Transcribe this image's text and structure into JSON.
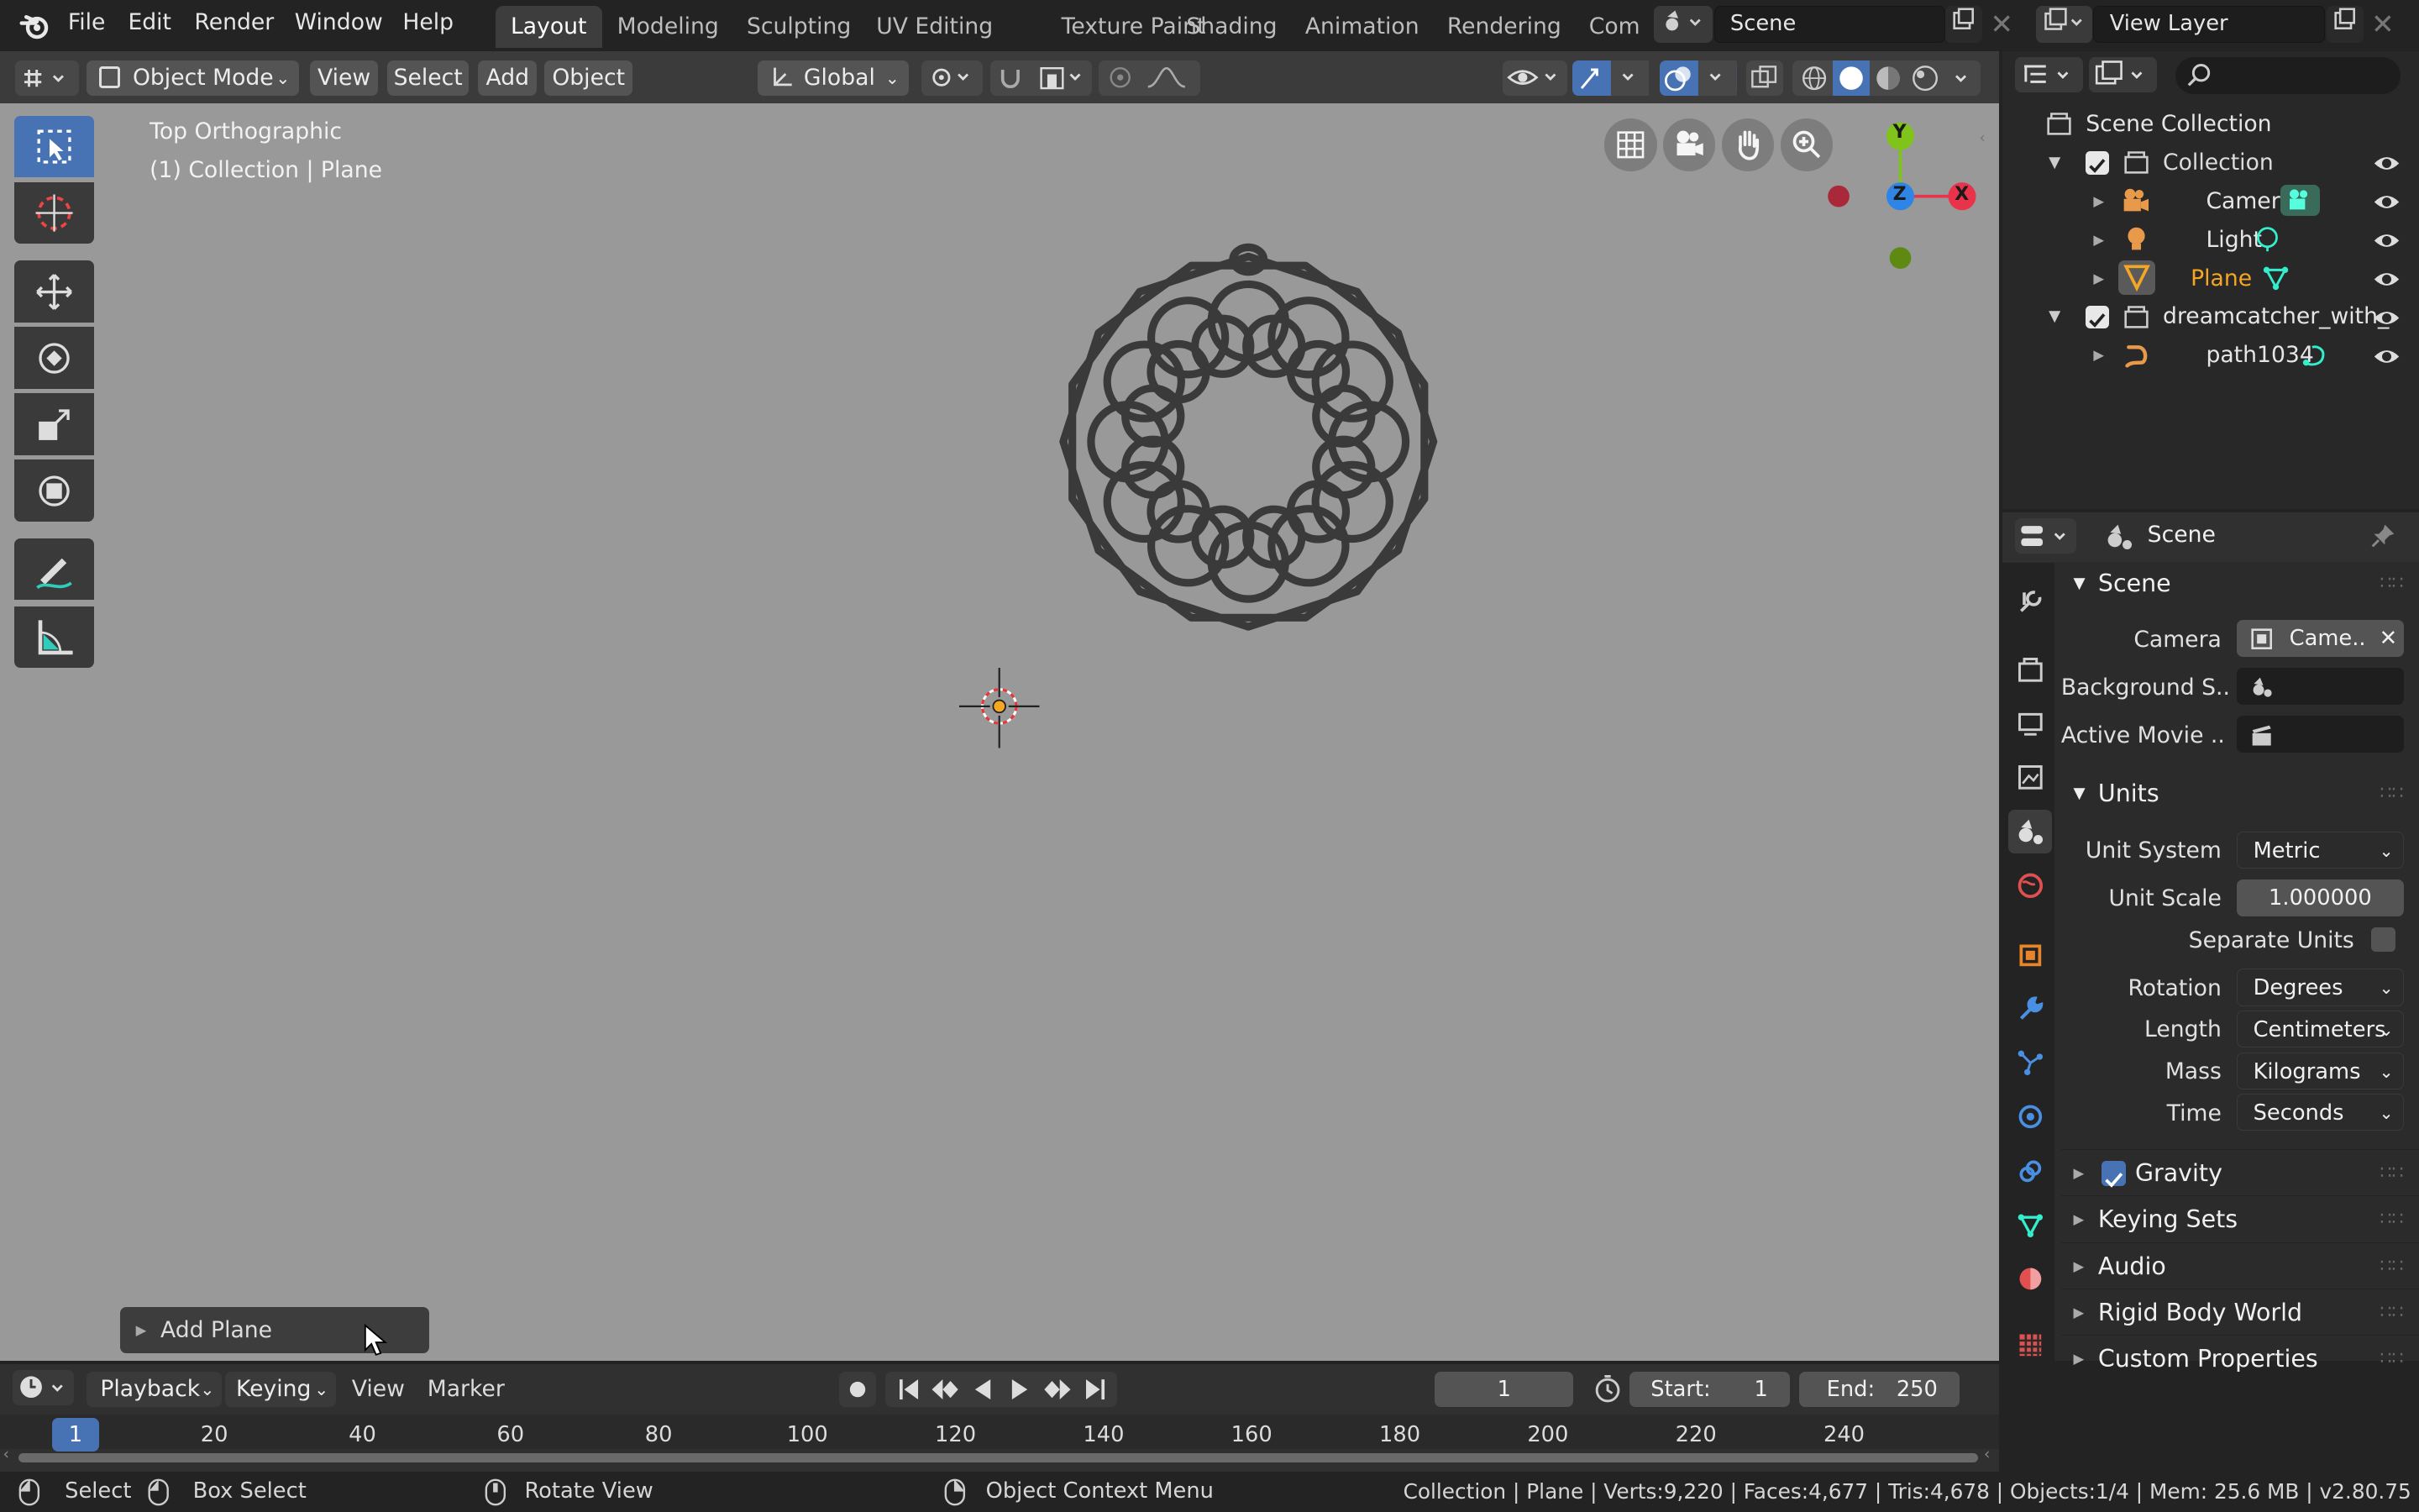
{
  "menus": [
    "File",
    "Edit",
    "Render",
    "Window",
    "Help"
  ],
  "workspaces": [
    "Layout",
    "Modeling",
    "Sculpting",
    "UV Editing",
    "Texture Paint",
    "Shading",
    "Animation",
    "Rendering",
    "Com"
  ],
  "scene_field": "Scene",
  "view_layer_field": "View Layer",
  "viewport_header": {
    "mode": "Object Mode",
    "view": "View",
    "select": "Select",
    "add": "Add",
    "object": "Object",
    "orientation": "Global"
  },
  "viewport": {
    "view_name": "Top Orthographic",
    "collection_info": "(1) Collection | Plane",
    "gizmo": {
      "y": "Y",
      "z": "Z",
      "x": "X"
    }
  },
  "operator_panel": "Add Plane",
  "outliner": {
    "scene_collection": "Scene Collection",
    "items": [
      {
        "label": "Collection",
        "type": "collection"
      },
      {
        "label": "Camera",
        "type": "camera"
      },
      {
        "label": "Light",
        "type": "light"
      },
      {
        "label": "Plane",
        "type": "mesh"
      },
      {
        "label": "dreamcatcher_with_",
        "type": "collection"
      },
      {
        "label": "path1034",
        "type": "curve"
      }
    ]
  },
  "properties": {
    "header": "Scene",
    "scene_section": "Scene",
    "camera_label": "Camera",
    "camera_value": "Came..",
    "background_label": "Background S..",
    "movie_label": "Active Movie ..",
    "units_section": "Units",
    "unit_system_label": "Unit System",
    "unit_system_value": "Metric",
    "unit_scale_label": "Unit Scale",
    "unit_scale_value": "1.000000",
    "separate_units_label": "Separate Units",
    "rotation_label": "Rotation",
    "rotation_value": "Degrees",
    "length_label": "Length",
    "length_value": "Centimeters",
    "mass_label": "Mass",
    "mass_value": "Kilograms",
    "time_label": "Time",
    "time_value": "Seconds",
    "collapsed_sections": [
      "Gravity",
      "Keying Sets",
      "Audio",
      "Rigid Body World",
      "Custom Properties"
    ]
  },
  "timeline": {
    "playback": "Playback",
    "keying": "Keying",
    "view": "View",
    "marker": "Marker",
    "current_frame": "1",
    "start_label": "Start:",
    "start_value": "1",
    "end_label": "End:",
    "end_value": "250",
    "ruler": [
      "1",
      "20",
      "40",
      "60",
      "80",
      "100",
      "120",
      "140",
      "160",
      "180",
      "200",
      "220",
      "240"
    ]
  },
  "statusbar": {
    "select": "Select",
    "box_select": "Box Select",
    "rotate_view": "Rotate View",
    "context_menu": "Object Context Menu",
    "stats": "Collection | Plane | Verts:9,220 | Faces:4,677 | Tris:4,678 | Objects:1/4 | Mem: 25.6 MB | v2.80.75"
  },
  "colors": {
    "accent": "#4772b3",
    "selected_object": "#f5a623",
    "viewport_bg": "#999999",
    "axis_x": "#e8334a",
    "axis_y": "#7fc31b",
    "axis_z": "#2f85e5"
  }
}
